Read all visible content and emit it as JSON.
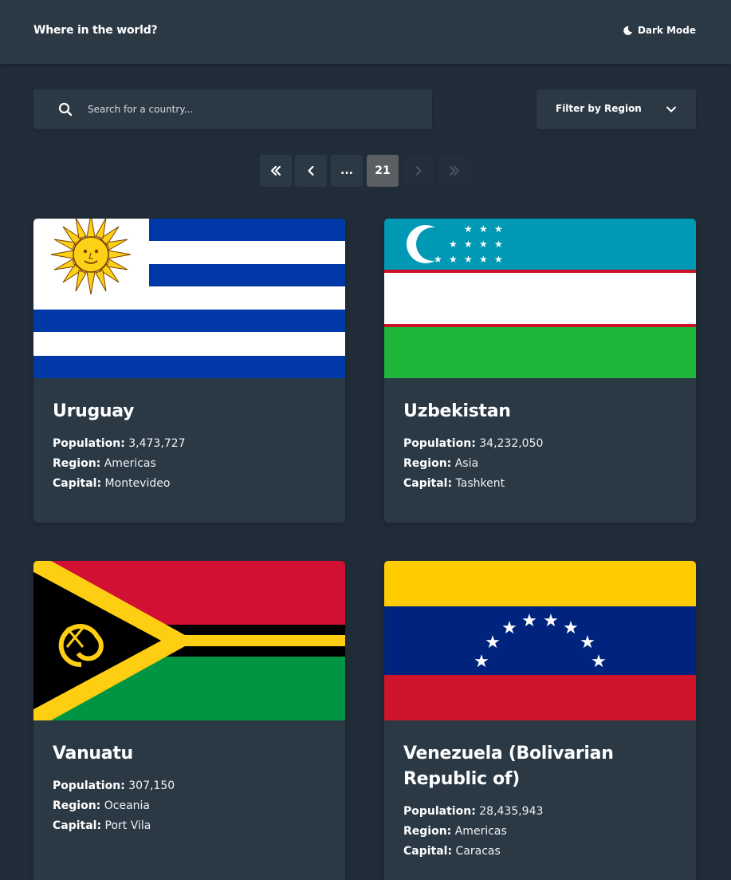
{
  "header": {
    "title": "Where in the world?",
    "theme_toggle_label": "Dark Mode"
  },
  "search": {
    "placeholder": "Search for a country..."
  },
  "filter": {
    "label": "Filter by Region"
  },
  "pagination": {
    "ellipsis": "...",
    "current_page": "21"
  },
  "field_labels": {
    "population": "Population:",
    "region": "Region:",
    "capital": "Capital:"
  },
  "countries": [
    {
      "name": "Uruguay",
      "population": "3,473,727",
      "region": "Americas",
      "capital": "Montevideo"
    },
    {
      "name": "Uzbekistan",
      "population": "34,232,050",
      "region": "Asia",
      "capital": "Tashkent"
    },
    {
      "name": "Vanuatu",
      "population": "307,150",
      "region": "Oceania",
      "capital": "Port Vila"
    },
    {
      "name": "Venezuela (Bolivarian Republic of)",
      "population": "28,435,943",
      "region": "Americas",
      "capital": "Caracas"
    }
  ],
  "colors": {
    "background": "#202c37",
    "surface": "#2b3945",
    "active_page": "#5b5f64",
    "text": "#ffffff"
  }
}
